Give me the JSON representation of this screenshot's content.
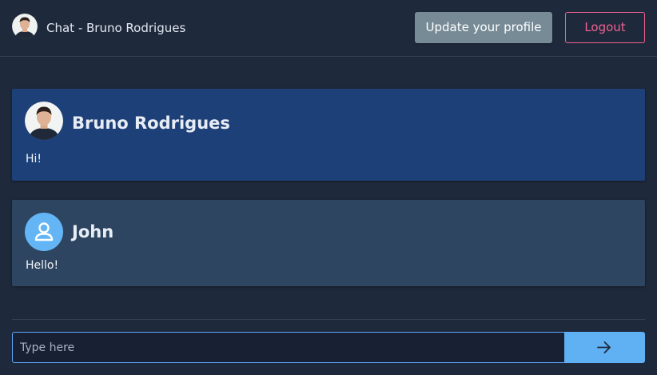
{
  "header": {
    "title": "Chat - Bruno Rodrigues",
    "avatar_icon": "user-photo-avatar",
    "update_profile_label": "Update your profile",
    "logout_label": "Logout"
  },
  "messages": [
    {
      "author": "Bruno Rodrigues",
      "text": "Hi!",
      "avatar": "user-photo-avatar",
      "own": true
    },
    {
      "author": "John",
      "text": "Hello!",
      "avatar": "person-icon",
      "own": false
    }
  ],
  "composer": {
    "placeholder": "Type here",
    "value": "",
    "send_icon": "arrow-right-icon"
  },
  "colors": {
    "background": "#1e293b",
    "own_message_bg": "#1e4078",
    "other_message_bg": "#2e4561",
    "profile_button_bg": "#778b97",
    "logout_accent": "#f06292",
    "send_button_bg": "#60b0f4",
    "input_border": "#60a5fa"
  }
}
